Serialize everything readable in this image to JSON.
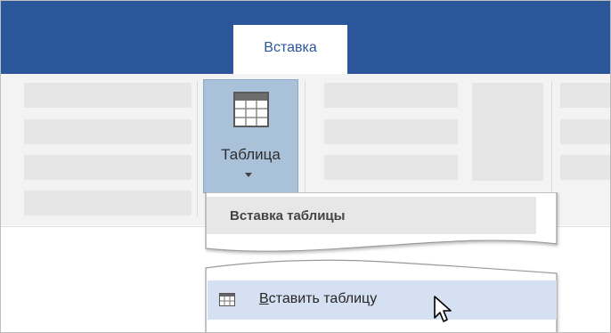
{
  "tabs": {
    "active_tab_label": "Вставка"
  },
  "ribbon": {
    "table_button": {
      "label": "Таблица",
      "icon": "table-grid-icon",
      "dropdown": "chevron-down-icon"
    }
  },
  "dropdown": {
    "header_title": "Вставка таблицы",
    "item": {
      "label_accel": "В",
      "label_rest": "ставить таблицу",
      "icon": "table-small-icon"
    }
  },
  "cursor": {
    "icon": "mouse-pointer-icon"
  },
  "colors": {
    "title_bar": "#2b579a",
    "ribbon_bg": "#f3f3f3",
    "pressed_button": "#a9c1d9",
    "menu_highlight": "#d5e1f2"
  }
}
